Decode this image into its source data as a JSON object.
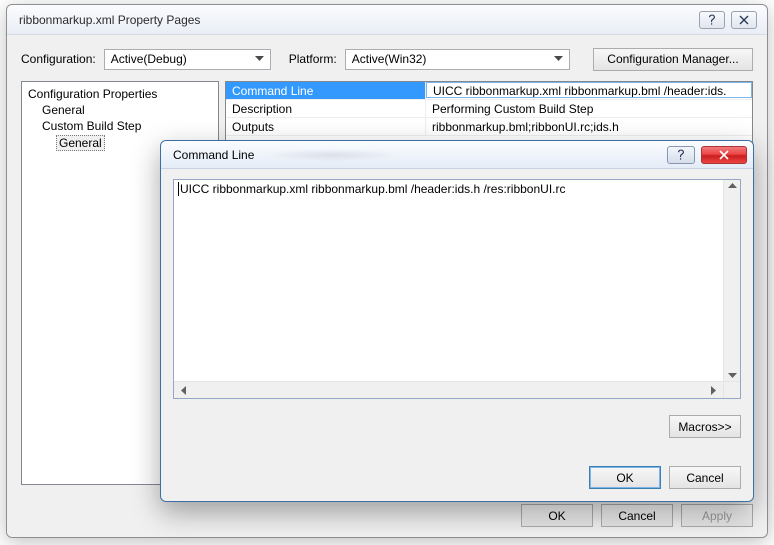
{
  "window": {
    "title": "ribbonmarkup.xml Property Pages"
  },
  "toolbar": {
    "configuration_label": "Configuration:",
    "configuration_value": "Active(Debug)",
    "platform_label": "Platform:",
    "platform_value": "Active(Win32)",
    "configuration_manager_label": "Configuration Manager..."
  },
  "tree": {
    "root": "Configuration Properties",
    "n1": "General",
    "n2": "Custom Build Step",
    "n2a": "General"
  },
  "props": {
    "rows": [
      {
        "name": "Command Line",
        "value": "UICC ribbonmarkup.xml ribbonmarkup.bml /header:ids."
      },
      {
        "name": "Description",
        "value": "Performing Custom Build Step"
      },
      {
        "name": "Outputs",
        "value": "ribbonmarkup.bml;ribbonUI.rc;ids.h"
      }
    ]
  },
  "buttons": {
    "ok": "OK",
    "cancel": "Cancel",
    "apply": "Apply"
  },
  "dialog": {
    "title": "Command Line",
    "text": "UICC ribbonmarkup.xml ribbonmarkup.bml /header:ids.h  /res:ribbonUI.rc",
    "macros": "Macros>>",
    "ok": "OK",
    "cancel": "Cancel"
  },
  "icons": {
    "help": "help-icon",
    "close": "close-icon",
    "chevron_down": "chevron-down-icon",
    "scroll_up": "scroll-up-arrow",
    "scroll_down": "scroll-down-arrow",
    "scroll_left": "scroll-left-arrow",
    "scroll_right": "scroll-right-arrow"
  }
}
